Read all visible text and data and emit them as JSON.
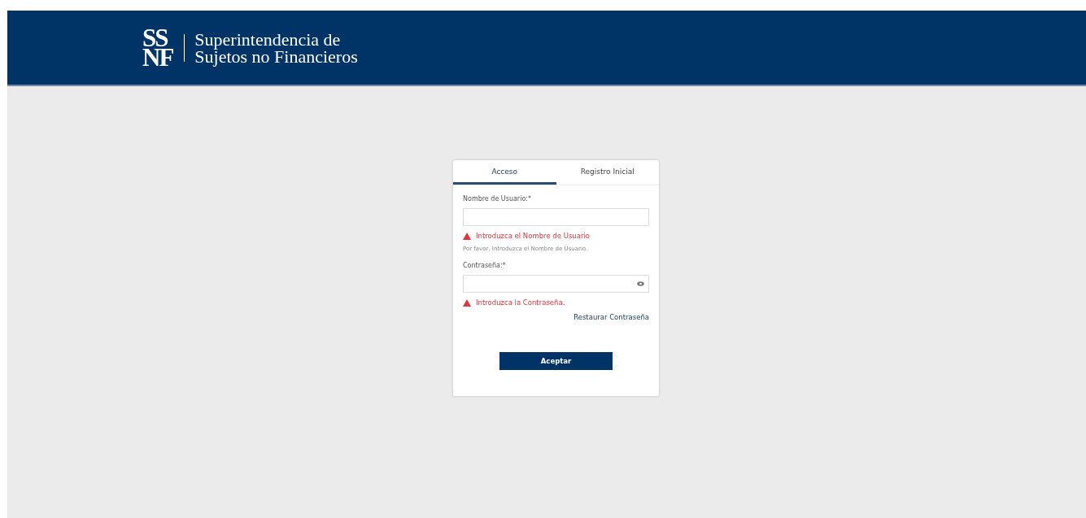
{
  "header": {
    "logo_lines": [
      "SS",
      "NF"
    ],
    "title_lines": [
      "Superintendencia de",
      "Sujetos no Financieros"
    ]
  },
  "tabs": [
    {
      "label": "Acceso",
      "selected": true
    },
    {
      "label": "Registro Inicial",
      "selected": false
    }
  ],
  "fields": [
    {
      "kind": "text",
      "label": "Nombre de Usuario:*",
      "error": "Introduzca el Nombre de Usuario",
      "hint": "Por favor, Introduzca el Nombre de Usuario."
    },
    {
      "kind": "password",
      "label": "Contraseña:*",
      "error": "Introduzca la Contraseña."
    }
  ],
  "restore_link": "Restaurar Contraseña",
  "submit_button": "Aceptar"
}
